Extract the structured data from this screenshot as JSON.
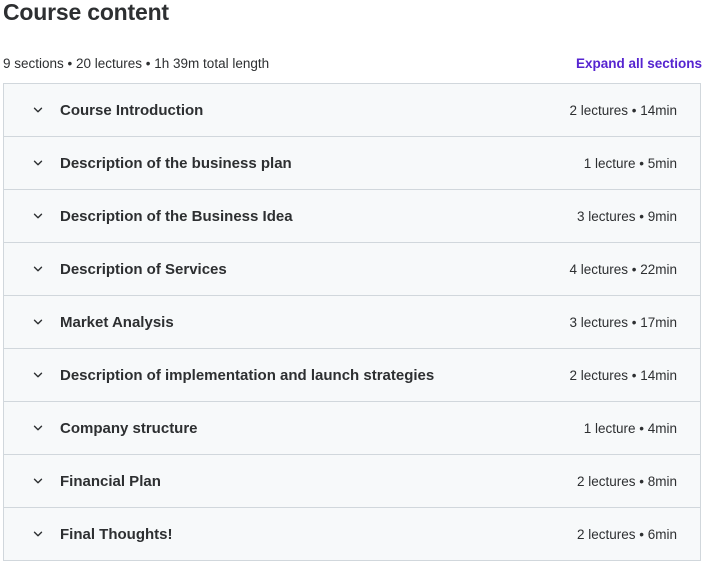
{
  "header": {
    "title": "Course content",
    "summary": "9 sections • 20 lectures • 1h 39m total length",
    "expand_all": "Expand all sections"
  },
  "sections": [
    {
      "title": "Course Introduction",
      "meta": "2 lectures • 14min"
    },
    {
      "title": "Description of the business plan",
      "meta": "1 lecture • 5min"
    },
    {
      "title": "Description of the Business Idea",
      "meta": "3 lectures • 9min"
    },
    {
      "title": "Description of Services",
      "meta": "4 lectures • 22min"
    },
    {
      "title": "Market Analysis",
      "meta": "3 lectures • 17min"
    },
    {
      "title": "Description of implementation and launch strategies",
      "meta": "2 lectures • 14min"
    },
    {
      "title": "Company structure",
      "meta": "1 lecture • 4min"
    },
    {
      "title": "Financial Plan",
      "meta": "2 lectures • 8min"
    },
    {
      "title": "Final Thoughts!",
      "meta": "2 lectures • 6min"
    }
  ],
  "colors": {
    "accent": "#5624d0",
    "text": "#2d2f31",
    "section_bg": "#f7f9fa",
    "border": "#d1d7dc"
  },
  "icons": {
    "section_toggle": "chevron-down-icon"
  }
}
